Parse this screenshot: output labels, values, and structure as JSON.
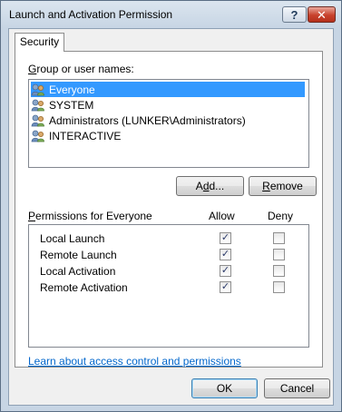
{
  "window": {
    "title": "Launch and Activation Permission",
    "help_label": "?",
    "close_label": "✕"
  },
  "tabs": [
    {
      "label": "Security"
    }
  ],
  "group": {
    "label_accel": "G",
    "label_rest": "roup or user names:",
    "items": [
      {
        "name": "Everyone",
        "icon": "users-icon",
        "selected": true
      },
      {
        "name": "SYSTEM",
        "icon": "users-icon",
        "selected": false
      },
      {
        "name": "Administrators (LUNKER\\Administrators)",
        "icon": "users-icon",
        "selected": false
      },
      {
        "name": "INTERACTIVE",
        "icon": "users-icon",
        "selected": false
      }
    ]
  },
  "buttons": {
    "add_pre": "A",
    "add_accel": "d",
    "add_post": "d...",
    "remove_accel": "R",
    "remove_post": "emove",
    "ok": "OK",
    "cancel": "Cancel"
  },
  "permissions": {
    "label_accel": "P",
    "label_rest": "ermissions for Everyone",
    "allow_header": "Allow",
    "deny_header": "Deny",
    "check_glyph": "✓",
    "rows": [
      {
        "name": "Local Launch",
        "allow": true,
        "deny": false
      },
      {
        "name": "Remote Launch",
        "allow": true,
        "deny": false
      },
      {
        "name": "Local Activation",
        "allow": true,
        "deny": false
      },
      {
        "name": "Remote Activation",
        "allow": true,
        "deny": false
      }
    ]
  },
  "link": {
    "text": "Learn about access control and permissions"
  },
  "colors": {
    "selection": "#3399ff",
    "link": "#0066cc",
    "close": "#c8412c"
  }
}
